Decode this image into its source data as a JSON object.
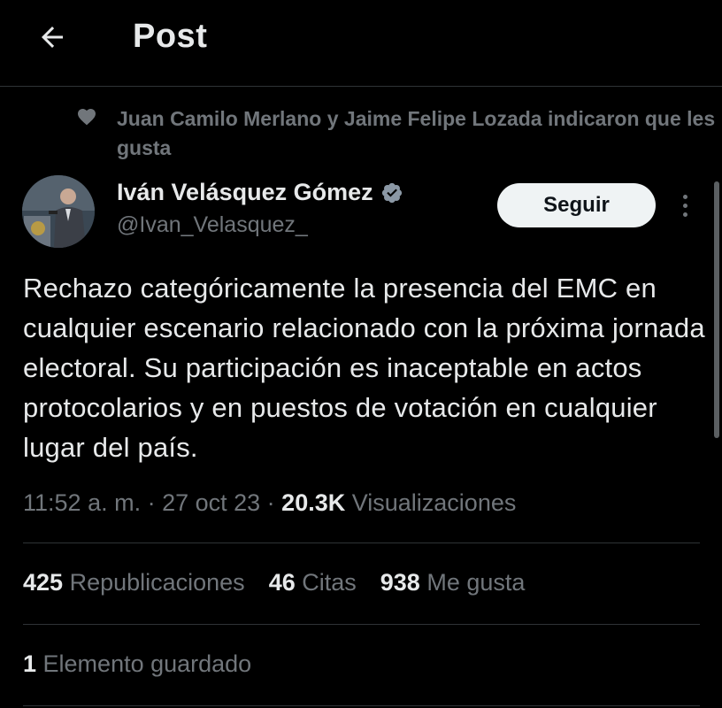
{
  "header": {
    "title": "Post",
    "back_icon": "arrow-left-icon"
  },
  "social_context": {
    "icon": "heart-icon",
    "text": "Juan Camilo Merlano y Jaime Felipe Lozada indicaron que les gusta"
  },
  "author": {
    "name": "Iván Velásquez Gómez",
    "handle": "@Ivan_Velasquez_",
    "verified_icon": "verified-badge-icon",
    "verified_color": "#8b98a5"
  },
  "follow_button": {
    "label": "Seguir"
  },
  "more_icon": "more-vertical-icon",
  "post": {
    "text": "Rechazo categóricamente la presencia del EMC en cualquier escenario relacionado con la próxima jornada electoral. Su participación es inaceptable en actos protocolarios y en puestos de votación en cualquier lugar del país."
  },
  "meta": {
    "time": "11:52 a. m.",
    "sep1": " · ",
    "date": "27 oct 23",
    "sep2": " · ",
    "views": "20.3K",
    "views_label": " Visualizaciones"
  },
  "stats": {
    "reposts": {
      "count": "425",
      "label": " Republicaciones"
    },
    "quotes": {
      "count": "46",
      "label": " Citas"
    },
    "likes": {
      "count": "938",
      "label": " Me gusta"
    }
  },
  "bookmarks": {
    "count": "1",
    "label": " Elemento guardado"
  },
  "colors": {
    "background": "#000000",
    "text_primary": "#e7e9ea",
    "text_secondary": "#71767b",
    "divider": "#2f3336",
    "button_bg": "#eff3f4"
  }
}
